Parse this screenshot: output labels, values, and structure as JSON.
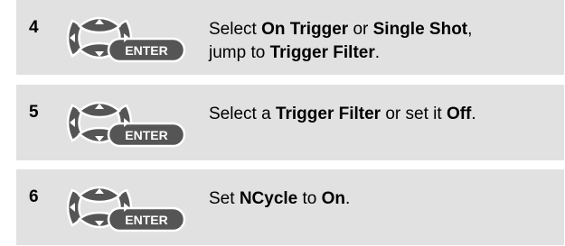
{
  "steps": [
    {
      "number": "4",
      "enter_label": "ENTER",
      "instruction": {
        "t1": "Select ",
        "b1": "On Trigger",
        "t2": " or ",
        "b2": "Single Shot",
        "t3": ",",
        "t4": "jump to ",
        "b3": "Trigger Filter",
        "t5": "."
      }
    },
    {
      "number": "5",
      "enter_label": "ENTER",
      "instruction": {
        "t1": "Select a ",
        "b1": "Trigger Filter",
        "t2": " or set it ",
        "b2": "Off",
        "t3": "."
      }
    },
    {
      "number": "6",
      "enter_label": "ENTER",
      "instruction": {
        "t1": "Set ",
        "b1": "NCycle",
        "t2": " to ",
        "b2": "On",
        "t3": "."
      }
    }
  ],
  "colors": {
    "row_background": "#e1e1e1",
    "key_fill": "#555555",
    "key_outline": "#ffffff"
  },
  "icons": {
    "keypad": "arrow-keys-enter-icon"
  }
}
